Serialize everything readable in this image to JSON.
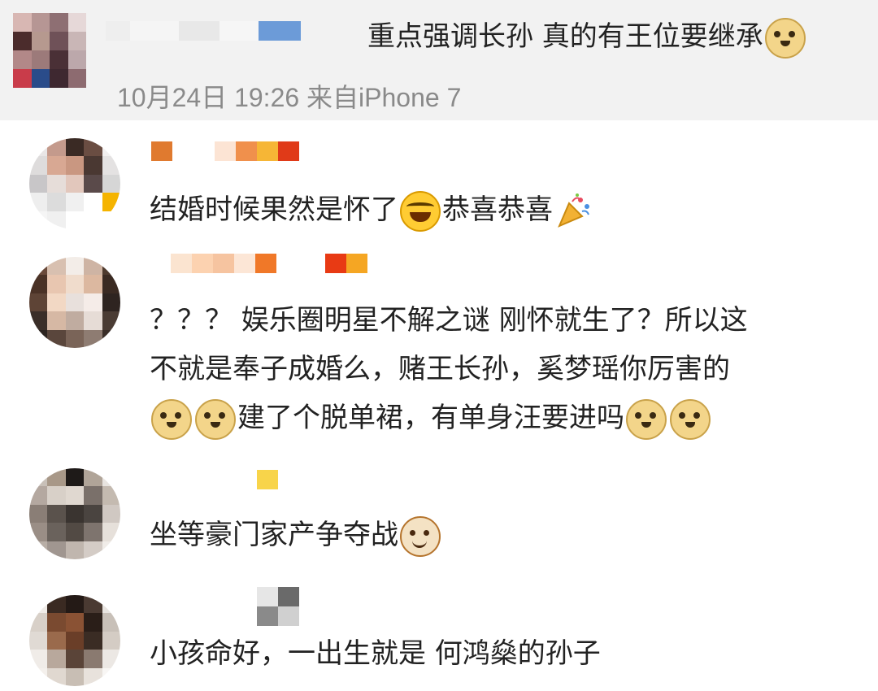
{
  "top_post": {
    "text": "重点强调长孙 真的有王位要继承",
    "emoji": "doge-icon",
    "meta": "10月24日 19:26 来自iPhone 7"
  },
  "comments": [
    {
      "text": "结婚时候果然是怀了",
      "text2": "恭喜恭喜",
      "emoji1": "laugh-cry-icon",
      "emoji2": "party-popper-icon"
    },
    {
      "line1": "？？？ 娱乐圈明星不解之谜 刚怀就生了？所以这",
      "line2": "不就是奉子成婚么，赌王长孙，奚梦瑶你厉害的",
      "line3": "建了个脱单裙，有单身汪要进吗",
      "emoji": "doge-icon"
    },
    {
      "text": "坐等豪门家产争夺战",
      "emoji": "cat-icon"
    },
    {
      "text": "小孩命好，一出生就是 何鸿燊的孙子"
    }
  ]
}
